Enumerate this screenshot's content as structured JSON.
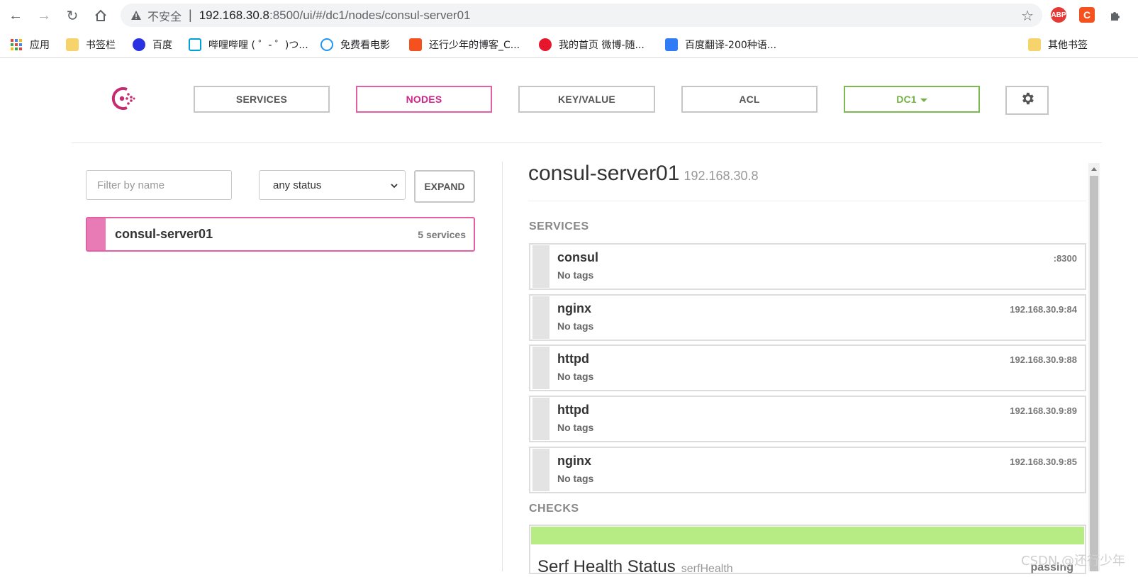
{
  "browser": {
    "insecure_label": "不安全",
    "url_host": "192.168.30.8",
    "url_rest": ":8500/ui/#/dc1/nodes/consul-server01",
    "extensions": [
      "ABP",
      "C"
    ],
    "bookmarks": [
      {
        "label": "应用",
        "icon": "apps-grid-icon"
      },
      {
        "label": "书签栏",
        "icon": "folder-icon"
      },
      {
        "label": "百度",
        "icon": "baidu-icon"
      },
      {
        "label": "哔哩哔哩 ( ゜- ゜)つ...",
        "icon": "bilibili-icon"
      },
      {
        "label": "免费看电影",
        "icon": "movie-icon"
      },
      {
        "label": "还行少年的博客_C...",
        "icon": "csdn-icon"
      },
      {
        "label": "我的首页 微博-随...",
        "icon": "weibo-icon"
      },
      {
        "label": "百度翻译-200种语...",
        "icon": "translate-icon"
      },
      {
        "label": "其他书签",
        "icon": "folder-icon"
      }
    ]
  },
  "nav": {
    "services": "SERVICES",
    "nodes": "NODES",
    "keyvalue": "KEY/VALUE",
    "acl": "ACL",
    "dc": "DC1"
  },
  "filters": {
    "name_placeholder": "Filter by name",
    "status_value": "any status",
    "expand": "EXPAND"
  },
  "nodes": [
    {
      "name": "consul-server01",
      "count": "5 services"
    }
  ],
  "detail": {
    "name": "consul-server01",
    "ip": "192.168.30.8",
    "services_label": "SERVICES",
    "checks_label": "CHECKS",
    "services": [
      {
        "name": "consul",
        "tags": "No tags",
        "addr": ":8300"
      },
      {
        "name": "nginx",
        "tags": "No tags",
        "addr": "192.168.30.9:84"
      },
      {
        "name": "httpd",
        "tags": "No tags",
        "addr": "192.168.30.9:88"
      },
      {
        "name": "httpd",
        "tags": "No tags",
        "addr": "192.168.30.9:89"
      },
      {
        "name": "nginx",
        "tags": "No tags",
        "addr": "192.168.30.9:85"
      }
    ],
    "check": {
      "name": "Serf Health Status",
      "id": "serfHealth",
      "status": "passing",
      "color": "#b7ec84"
    }
  },
  "watermark": "CSDN @还行少年",
  "colors": {
    "nodes_accent": "#e55fa4",
    "dc_accent": "#7cb950",
    "passing": "#b7ec84"
  }
}
